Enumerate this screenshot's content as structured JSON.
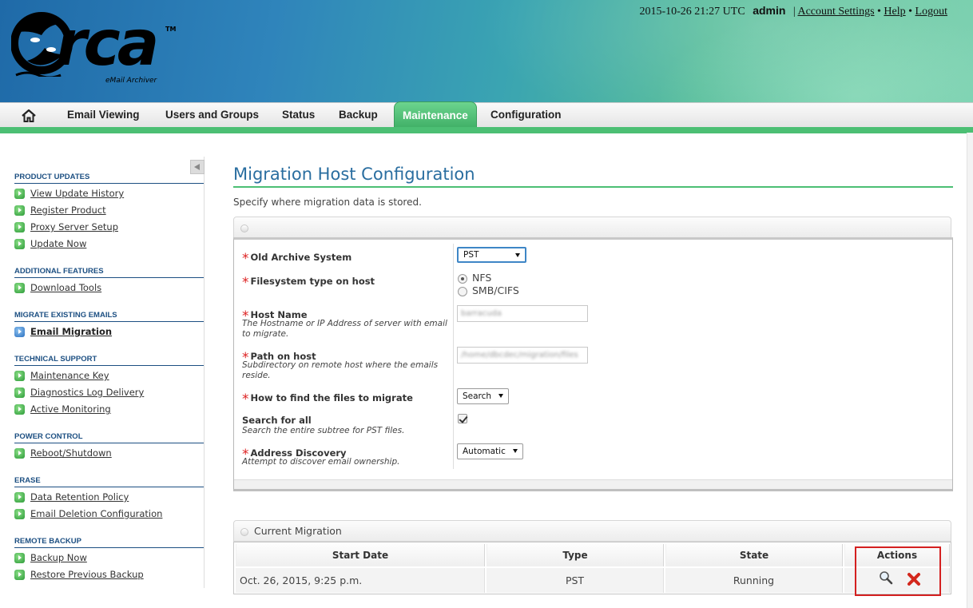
{
  "header": {
    "logo_text": "rca",
    "logo_tm": "TM",
    "logo_subtitle": "eMail Archiver",
    "datetime": "2015-10-26 21:27 UTC",
    "user": "admin",
    "separator": "|",
    "links": {
      "account": "Account Settings",
      "help": "Help",
      "logout": "Logout"
    },
    "bullet": "•"
  },
  "nav": {
    "home_icon": "home-icon",
    "items": [
      "Email Viewing",
      "Users and Groups",
      "Status",
      "Backup",
      "Maintenance",
      "Configuration"
    ],
    "active": "Maintenance"
  },
  "sidebar": {
    "sections": [
      {
        "title": "PRODUCT UPDATES",
        "items": [
          "View Update History",
          "Register Product",
          "Proxy Server Setup",
          "Update Now"
        ]
      },
      {
        "title": "ADDITIONAL FEATURES",
        "items": [
          "Download Tools"
        ]
      },
      {
        "title": "MIGRATE EXISTING EMAILS",
        "items": [
          "Email Migration"
        ]
      },
      {
        "title": "TECHNICAL SUPPORT",
        "items": [
          "Maintenance Key",
          "Diagnostics Log Delivery",
          "Active Monitoring"
        ]
      },
      {
        "title": "POWER CONTROL",
        "items": [
          "Reboot/Shutdown"
        ]
      },
      {
        "title": "ERASE",
        "items": [
          "Data Retention Policy",
          "Email Deletion Configuration"
        ]
      },
      {
        "title": "REMOTE BACKUP",
        "items": [
          "Backup Now",
          "Restore Previous Backup"
        ]
      }
    ],
    "current": "Email Migration"
  },
  "main": {
    "title": "Migration Host Configuration",
    "description": "Specify where migration data is stored.",
    "form": {
      "required_mark": "*",
      "old_archive": {
        "label": "Old Archive System",
        "value": "PST"
      },
      "fs_type": {
        "label": "Filesystem type on host",
        "options": [
          "NFS",
          "SMB/CIFS"
        ],
        "selected": "NFS"
      },
      "host_name": {
        "label": "Host Name",
        "hint": "The Hostname or IP Address of server with email to migrate.",
        "value": "barracuda"
      },
      "path": {
        "label": "Path on host",
        "hint": "Subdirectory on remote host where the emails reside.",
        "value": "/home/dbcdec/migration/files"
      },
      "find_files": {
        "label": "How to find the files to migrate",
        "value": "Search"
      },
      "search_all": {
        "label": "Search for all",
        "hint": "Search the entire subtree for PST files.",
        "checked": true
      },
      "address_discovery": {
        "label": "Address Discovery",
        "hint": "Attempt to discover email ownership.",
        "value": "Automatic"
      }
    },
    "current_migration": {
      "title": "Current Migration",
      "columns": [
        "Start Date",
        "Type",
        "State",
        "Actions"
      ],
      "rows": [
        {
          "start_date": "Oct. 26, 2015, 9:25 p.m.",
          "type": "PST",
          "state": "Running",
          "actions": [
            "magnifier-icon",
            "delete-icon"
          ]
        }
      ]
    }
  },
  "colors": {
    "accent_green": "#4cbf74",
    "title_blue": "#2a6ea0",
    "required_red": "#d22",
    "highlight_red": "#d42020"
  }
}
